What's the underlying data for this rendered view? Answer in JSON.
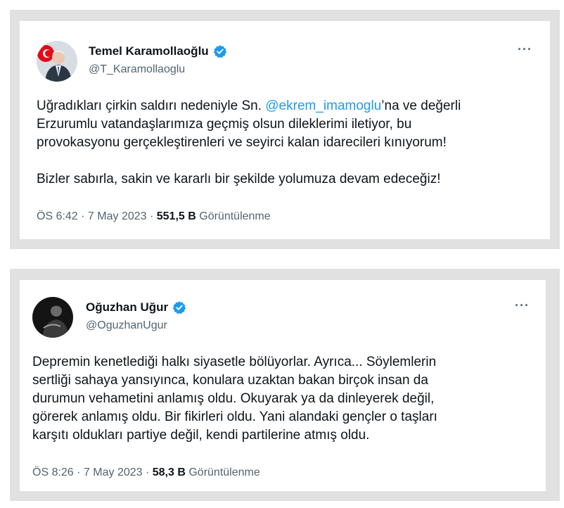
{
  "tweets": [
    {
      "name": "Temel Karamollaoğlu",
      "handle": "@T_Karamollaoglu",
      "more": "···",
      "text_before": "Uğradıkları çirkin saldırı nedeniyle Sn. ",
      "mention": "@ekrem_imamoglu",
      "text_after": "’na ve değerli\nErzurumlu vatandaşlarımıza geçmiş olsun dileklerimi iletiyor, bu\nprovokasyonu gerçekleştirenleri ve seyirci kalan idarecileri kınıyorum!\n\nBizler sabırla, sakin ve kararlı bir şekilde yolumuza devam edeceğiz!",
      "time": "ÖS 6:42",
      "date": "7 May 2023",
      "views_count": "551,5 B",
      "views_label": "Görüntülenme",
      "verified_color": "#1d9bf0"
    },
    {
      "name": "Oğuzhan Uğur",
      "handle": "@OguzhanUgur",
      "more": "···",
      "text": "Depremin kenetlediği halkı siyasetle bölüyorlar. Ayrıca... Söylemlerin\nsertliği sahaya yansıyınca, konulara uzaktan bakan birçok insan da\ndurumun vehametini anlamış oldu. Okuyarak ya da dinleyerek değil,\ngörerek anlamış oldu. Bir fikirleri oldu. Yani alandaki gençler o taşları\nkarşıtı oldukları partiye değil, kendi partilerine atmış oldu.",
      "time": "ÖS 8:26",
      "date": "7 May 2023",
      "views_count": "58,3 B",
      "views_label": "Görüntülenme",
      "verified_color": "#1d9bf0"
    }
  ]
}
